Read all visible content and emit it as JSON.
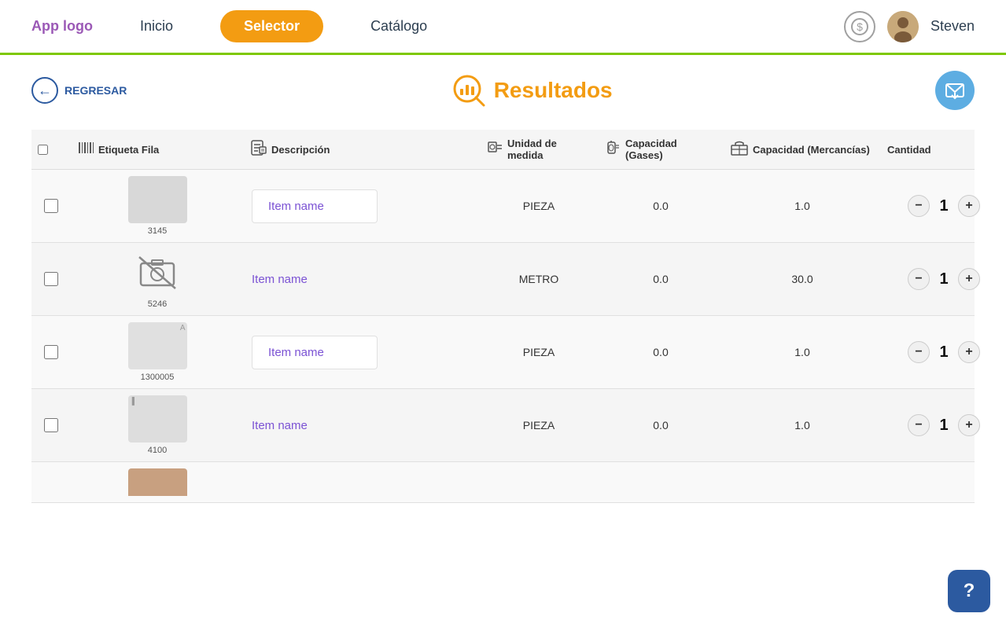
{
  "navbar": {
    "logo": "App logo",
    "inicio": "Inicio",
    "selector": "Selector",
    "catalogo": "Catálogo",
    "username": "Steven"
  },
  "toolbar": {
    "back_label": "REGRESAR",
    "title": "Resultados",
    "email_icon": "email-icon"
  },
  "table": {
    "headers": {
      "etiqueta": "Etiqueta Fila",
      "descripcion": "Descripción",
      "unidad": "Unidad de medida",
      "capacidad_gases": "Capacidad (Gases)",
      "capacidad_mercancias": "Capacidad (Mercancías)",
      "cantidad": "Cantidad"
    },
    "rows": [
      {
        "id": "3145",
        "has_image": true,
        "item_name": "Item name",
        "unit": "PIEZA",
        "gas": "0.0",
        "merch": "1.0",
        "qty": "1"
      },
      {
        "id": "5246",
        "has_image": false,
        "item_name": "Item name",
        "unit": "METRO",
        "gas": "0.0",
        "merch": "30.0",
        "qty": "1"
      },
      {
        "id": "1300005",
        "has_image": true,
        "item_name": "Item name",
        "unit": "PIEZA",
        "gas": "0.0",
        "merch": "1.0",
        "qty": "1"
      },
      {
        "id": "4100",
        "has_image": true,
        "item_name": "Item name",
        "unit": "PIEZA",
        "gas": "0.0",
        "merch": "1.0",
        "qty": "1"
      }
    ]
  },
  "help": {
    "label": "?"
  }
}
